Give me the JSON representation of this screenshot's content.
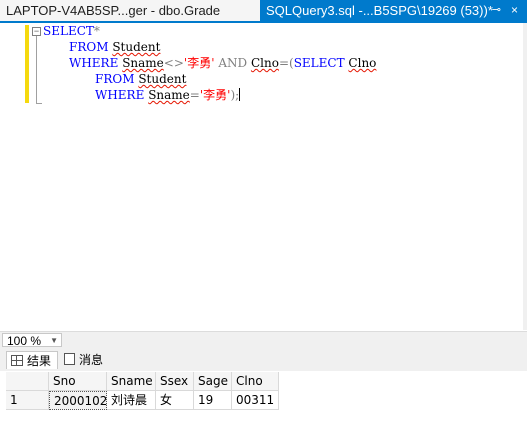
{
  "tabs": {
    "inactive_label": "LAPTOP-V4AB5SP...ger - dbo.Grade",
    "active_label": "SQLQuery3.sql -...B5SPG\\19269 (53))*",
    "pin_icon": "pin-icon",
    "close_icon": "close-icon"
  },
  "editor": {
    "lines": [
      {
        "t1": "SELECT",
        "t2": "*"
      },
      {
        "t1": "FROM",
        "t2": "Student"
      },
      {
        "t1": "WHERE",
        "t2": "Sname",
        "t3": "<>",
        "t4": "'李勇'",
        "t5": "AND",
        "t6": "Clno",
        "t7": "=(",
        "t8": "SELECT",
        "t9": "Clno"
      },
      {
        "t1": "FROM",
        "t2": "Student"
      },
      {
        "t1": "WHERE",
        "t2": "Sname",
        "t3": "=",
        "t4": "'李勇'",
        "t5": ");"
      }
    ]
  },
  "zoom": {
    "value": "100 %"
  },
  "results": {
    "tab_results": "结果",
    "tab_messages": "消息",
    "columns": [
      "Sno",
      "Sname",
      "Ssex",
      "Sage",
      "Clno"
    ],
    "rows": [
      {
        "num": "1",
        "cells": [
          "2000102",
          "刘诗晨",
          "女",
          "19",
          "00311"
        ]
      }
    ]
  },
  "colors": {
    "accent": "#007acc",
    "keyword": "#0000ff",
    "string": "#ff0000"
  }
}
